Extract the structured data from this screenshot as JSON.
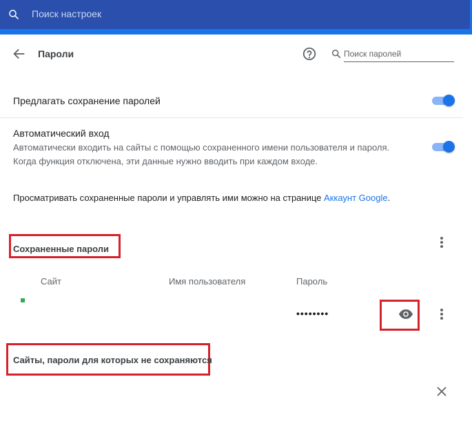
{
  "search": {
    "placeholder": "Поиск настроек"
  },
  "header": {
    "title": "Пароли",
    "search_placeholder": "Поиск паролей"
  },
  "settings": {
    "offer_save": {
      "label": "Предлагать сохранение паролей",
      "enabled": true
    },
    "auto_signin": {
      "label": "Автоматический вход",
      "description_line1": "Автоматически входить на сайты с помощью сохраненного имени пользователя и пароля.",
      "description_line2": "Когда функция отключена, эти данные нужно вводить при каждом входе.",
      "enabled": true
    },
    "manage_text": "Просматривать сохраненные пароли и управлять ими можно на странице ",
    "manage_link": "Аккаунт Google",
    "manage_tail": "."
  },
  "saved": {
    "title": "Сохраненные пароли",
    "columns": {
      "site": "Сайт",
      "username": "Имя пользователя",
      "password": "Пароль"
    },
    "rows": [
      {
        "site": "",
        "username": "",
        "password_masked": "••••••••"
      }
    ]
  },
  "never_saved": {
    "title": "Сайты, пароли для которых не сохраняются"
  },
  "colors": {
    "topbar": "#1a73e8",
    "searchbox": "#2a4fac",
    "accent": "#1a73e8",
    "highlight_box": "#d6202a",
    "favicon": "#34a853"
  },
  "icons": {
    "search": "search-icon",
    "back": "arrow-back-icon",
    "help": "help-circle-icon",
    "more": "more-vert-icon",
    "show_password": "eye-icon",
    "remove": "close-icon"
  }
}
